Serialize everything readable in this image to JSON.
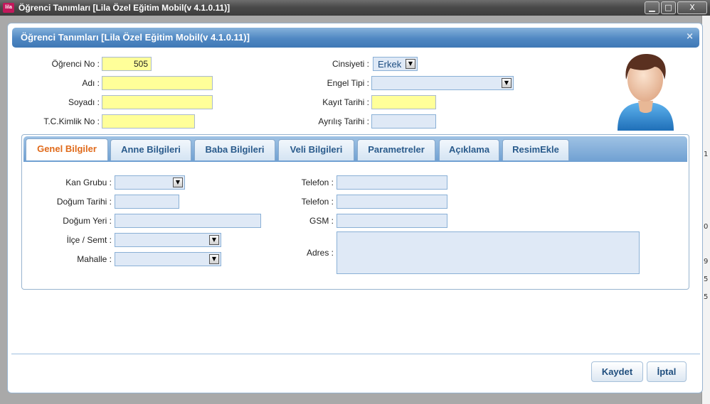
{
  "window": {
    "title": "Öğrenci Tanımları [Lila Özel Eğitim Mobil(v 4.1.0.11)]",
    "app_icon_text": "lila"
  },
  "dialog": {
    "title": "Öğrenci Tanımları [Lila Özel Eğitim Mobil(v 4.1.0.11)]",
    "close_glyph": "×"
  },
  "student": {
    "no_label": "Öğrenci No :",
    "no_value": "505",
    "ad_label": "Adı :",
    "ad_value": "",
    "soyad_label": "Soyadı :",
    "soyad_value": "",
    "tc_label": "T.C.Kimlik No :",
    "tc_value": "",
    "cinsiyet_label": "Cinsiyeti :",
    "cinsiyet_value": "Erkek",
    "engel_label": "Engel Tipi :",
    "engel_value": "",
    "kayit_label": "Kayıt Tarihi :",
    "kayit_value": "",
    "ayrilis_label": "Ayrılış Tarihi :",
    "ayrilis_value": ""
  },
  "tabs": [
    {
      "label": "Genel Bilgiler",
      "active": true
    },
    {
      "label": "Anne Bilgileri"
    },
    {
      "label": "Baba Bilgileri"
    },
    {
      "label": "Veli Bilgileri"
    },
    {
      "label": "Parametreler"
    },
    {
      "label": "Açıklama"
    },
    {
      "label": "ResimEkle"
    }
  ],
  "genel": {
    "kan_label": "Kan Grubu :",
    "dogum_tarihi_label": "Doğum Tarihi :",
    "dogum_yeri_label": "Doğum Yeri :",
    "ilce_label": "İlçe / Semt :",
    "mahalle_label": "Mahalle :",
    "telefon1_label": "Telefon :",
    "telefon2_label": "Telefon :",
    "gsm_label": "GSM :",
    "adres_label": "Adres :"
  },
  "buttons": {
    "save": "Kaydet",
    "cancel": "İptal"
  },
  "window_buttons": {
    "minimize": "▁",
    "maximize": "□",
    "close": "X"
  },
  "background_chars": [
    "1",
    "0",
    "9",
    "5",
    "5"
  ],
  "colors": {
    "required_field": "#ffff99",
    "field": "#dfe9f6",
    "active_tab_text": "#e06a1a",
    "header": "#4f87c2"
  }
}
